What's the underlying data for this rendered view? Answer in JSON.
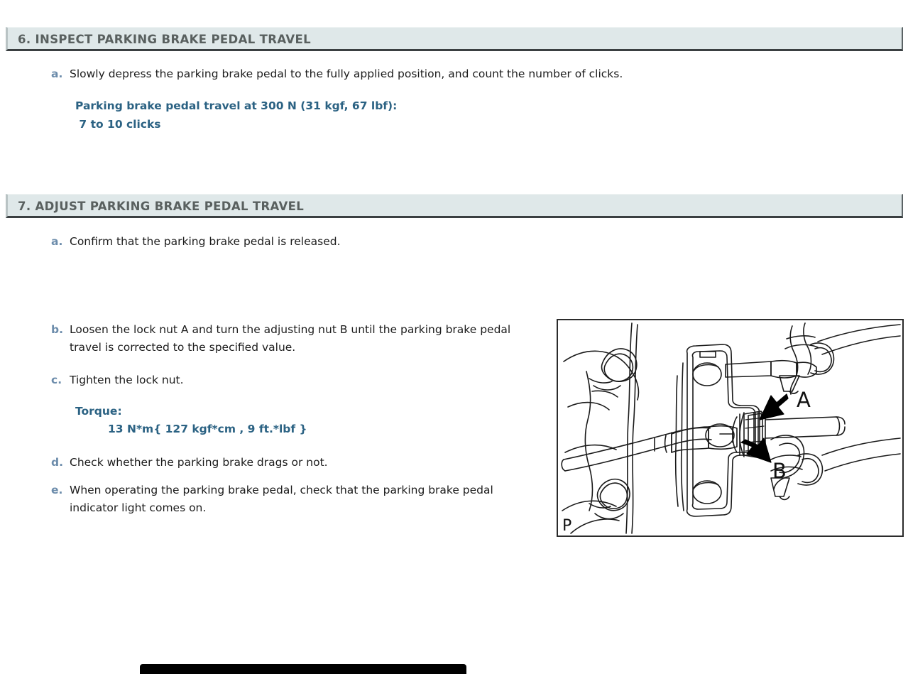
{
  "document": {
    "sections": [
      {
        "id": "inspect-parking-brake-pedal-travel",
        "heading": "6. INSPECT PARKING BRAKE PEDAL TRAVEL",
        "steps": [
          {
            "letter": "a.",
            "text": "Slowly depress the parking brake pedal to the fully applied position, and count the number of clicks."
          }
        ],
        "spec": {
          "title": "Parking brake pedal travel at 300 N (31 kgf, 67 lbf):",
          "value": " 7 to 10 clicks"
        }
      },
      {
        "id": "adjust-parking-brake-pedal-travel",
        "heading": "7. ADJUST PARKING BRAKE PEDAL TRAVEL",
        "steps": [
          {
            "letter": "a.",
            "text": "Confirm that the parking brake pedal is released."
          },
          {
            "letter": "b.",
            "text": "Loosen the lock nut A and turn the adjusting nut B until the parking brake pedal travel is corrected to the specified value."
          },
          {
            "letter": "c.",
            "text": "Tighten the lock nut."
          },
          {
            "letter": "d.",
            "text": "Check whether the parking brake drags or not."
          },
          {
            "letter": "e.",
            "text": "When operating the parking brake pedal, check that the parking brake pedal indicator light comes on."
          }
        ],
        "torque": {
          "title": "Torque:",
          "value": "13 N*m{ 127 kgf*cm , 9 ft.*lbf }"
        }
      }
    ],
    "figure": {
      "caption_letter": "P",
      "callouts": [
        {
          "label": "A",
          "refers_to": "lock nut"
        },
        {
          "label": "B",
          "refers_to": "adjusting nut"
        }
      ]
    }
  },
  "colors": {
    "header_background": "#dfe8e9",
    "header_text": "#59605f",
    "step_letter": "#6c8cab",
    "spec_text": "#2b6283",
    "body_text": "#1c1c1c",
    "figure_border": "#2b2b2b",
    "bottom_bar": "#000000"
  }
}
